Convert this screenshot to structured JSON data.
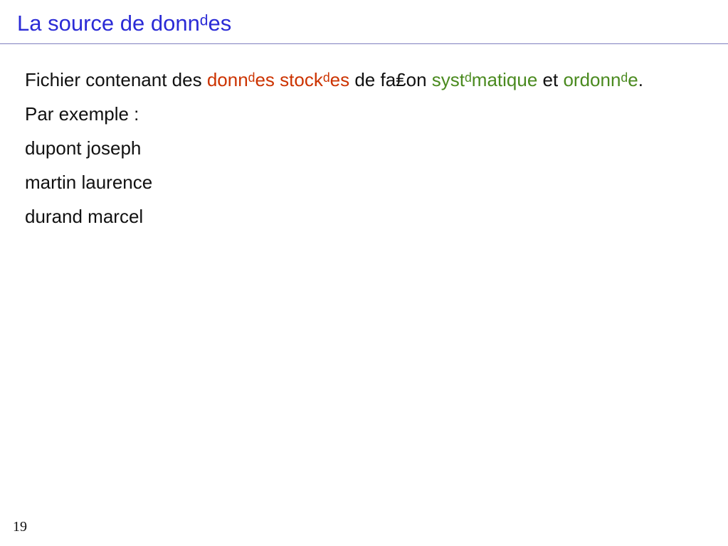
{
  "slide": {
    "title": "La source de donnᵈes",
    "page_number": "19"
  },
  "content": {
    "definition": {
      "p1": "Fichier contenant des ",
      "highlight1": "donnᵈes stockᵈes",
      "p2": " de fa₤on ",
      "highlight2": "systᵈmatique",
      "p3": " et ",
      "highlight3": "ordonnᵈe",
      "p4": "."
    },
    "example_intro": "Par exemple :",
    "examples": [
      "dupont joseph",
      "martin laurence",
      "durand marcel"
    ]
  },
  "colors": {
    "title": "#2b2bd6",
    "highlight_red": "#cc3300",
    "highlight_green": "#4a8a1f"
  }
}
